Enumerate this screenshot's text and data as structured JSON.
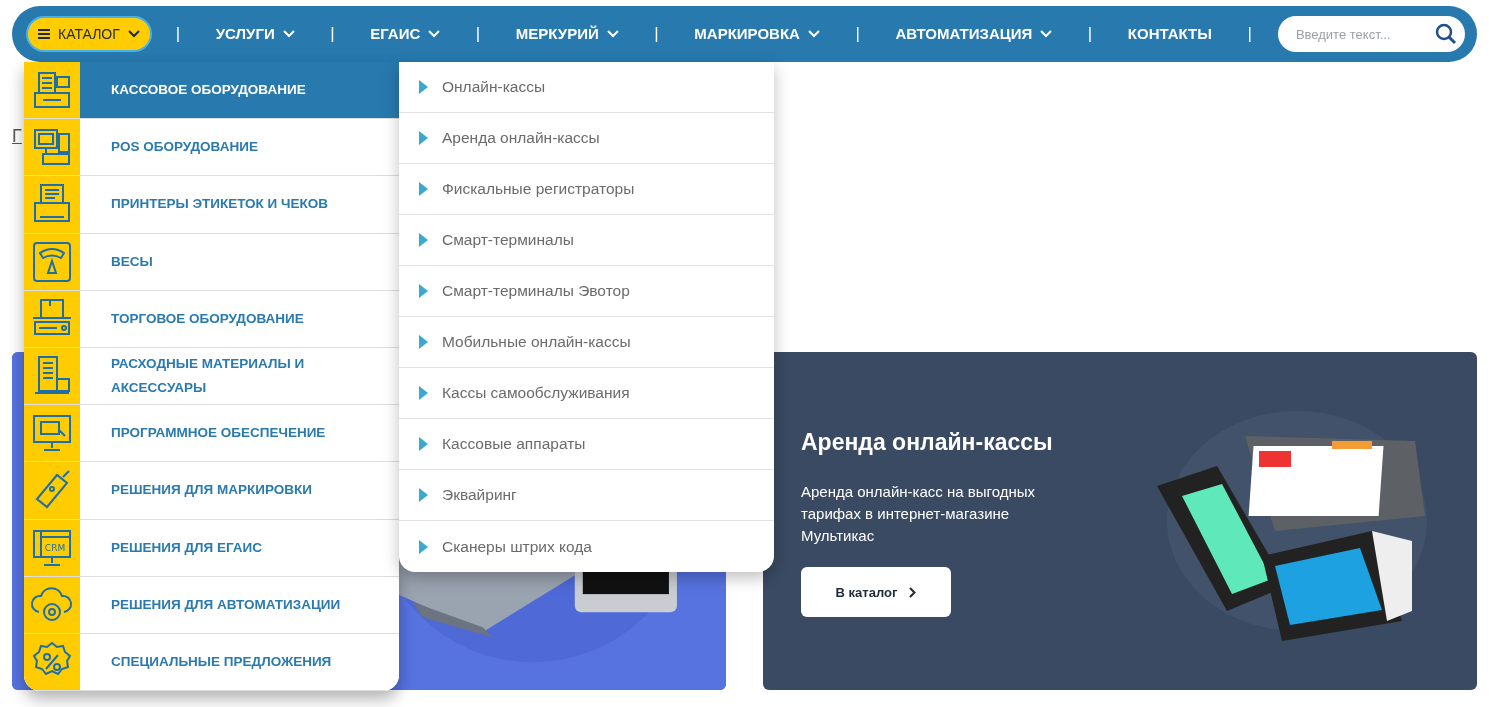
{
  "nav": {
    "catalog_button": {
      "label": "КАТАЛОГ",
      "expanded": true,
      "separator": "|"
    },
    "items": [
      {
        "label": "УСЛУГИ",
        "dropdown": true,
        "separator": "|"
      },
      {
        "label": "ЕГАИС",
        "dropdown": true,
        "separator": "|"
      },
      {
        "label": "МЕРКУРИЙ",
        "dropdown": true,
        "separator": "|"
      },
      {
        "label": "МАРКИРОВКА",
        "dropdown": true,
        "separator": "|"
      },
      {
        "label": "АВТОМАТИЗАЦИЯ",
        "dropdown": true,
        "separator": "|"
      },
      {
        "label": "КОНТАКТЫ",
        "dropdown": false,
        "separator": "|"
      }
    ],
    "search": {
      "placeholder": "Введите текст..."
    }
  },
  "page": {
    "breadcrumb": "Г"
  },
  "catalog_menu": {
    "categories": [
      {
        "label": "КАССОВОЕ ОБОРУДОВАНИЕ",
        "kind": "register",
        "selected": true
      },
      {
        "label": "POS ОБОРУДОВАНИЕ",
        "kind": "pos",
        "selected": false
      },
      {
        "label": "ПРИНТЕРЫ ЭТИКЕТОК И ЧЕКОВ",
        "kind": "printer",
        "selected": false
      },
      {
        "label": "ВЕСЫ",
        "kind": "scales",
        "selected": false
      },
      {
        "label": "ТОРГОВОЕ ОБОРУДОВАНИЕ",
        "kind": "trade",
        "selected": false
      },
      {
        "label": "РАСХОДНЫЕ МАТЕРИАЛЫ И АКСЕССУАРЫ",
        "kind": "consumables",
        "selected": false
      },
      {
        "label": "ПРОГРАММНОЕ ОБЕСПЕЧЕНИЕ",
        "kind": "software",
        "selected": false
      },
      {
        "label": "РЕШЕНИЯ ДЛЯ МАРКИРОВКИ",
        "kind": "tag",
        "selected": false
      },
      {
        "label": "РЕШЕНИЯ ДЛЯ ЕГАИС",
        "kind": "crm",
        "selected": false
      },
      {
        "label": "РЕШЕНИЯ ДЛЯ АВТОМАТИЗАЦИИ",
        "kind": "cloud",
        "selected": false
      },
      {
        "label": "СПЕЦИАЛЬНЫЕ ПРЕДЛОЖЕНИЯ",
        "kind": "percent",
        "selected": false
      }
    ],
    "crm_icon_text": "CRM",
    "submenu": [
      "Онлайн-кассы",
      "Аренда онлайн-кассы",
      "Фискальные регистраторы",
      "Смарт-терминалы",
      "Смарт-терминалы Эвотор",
      "Мобильные онлайн-кассы",
      "Кассы самообслуживания",
      "Кассовые аппараты",
      "Эквайринг",
      "Сканеры штрих кода"
    ]
  },
  "banners": [
    {
      "kind": "picture"
    },
    {
      "kind": "promo",
      "title": "Аренда онлайн-кассы",
      "text": "Аренда онлайн-касс на выгодных тарифах в интернет-магазине Мультикас",
      "button": "В каталог"
    }
  ]
}
